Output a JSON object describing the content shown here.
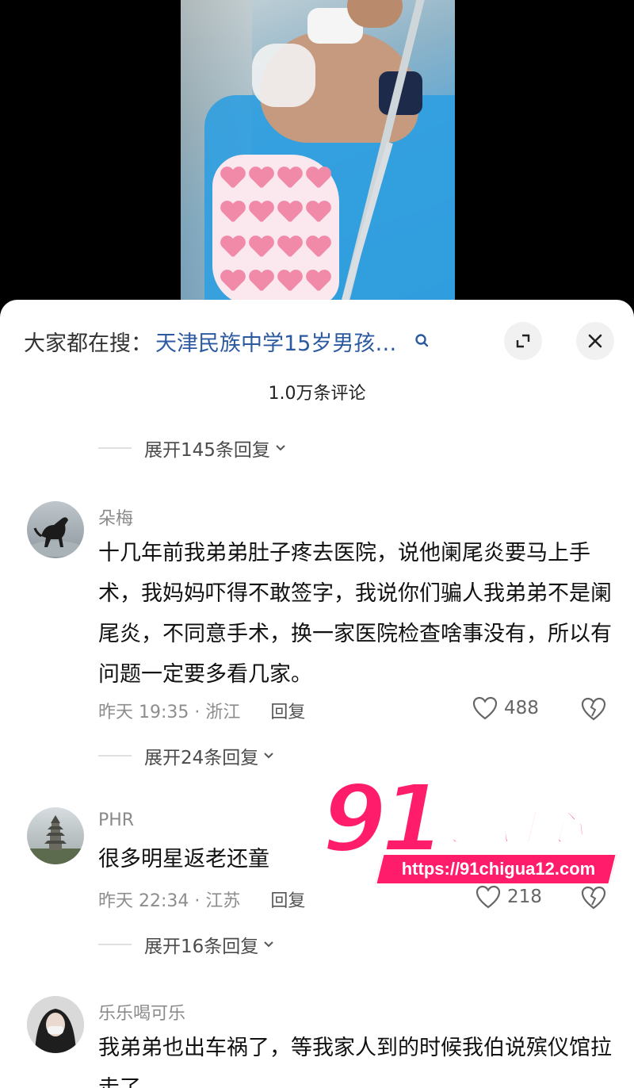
{
  "search": {
    "prefix": "大家都在搜：",
    "query": "天津民族中学15岁男孩…"
  },
  "header": {
    "comment_count": "1.0万条评论"
  },
  "top_reply_expand": "展开145条回复",
  "comments": [
    {
      "username": "朵梅",
      "text": "十几年前我弟弟肚子疼去医院，说他阑尾炎要马上手术，我妈妈吓得不敢签字，我说你们骗人我弟弟不是阑尾炎，不同意手术，换一家医院检查啥事没有，所以有问题一定要多看几家。",
      "meta": "昨天 19:35 · 浙江",
      "reply_label": "回复",
      "likes": "488",
      "expand_replies": "展开24条回复",
      "avatar_icon": "black-horse-avatar"
    },
    {
      "username": "PHR",
      "text": "很多明星返老还童",
      "meta": "昨天 22:34 · 江苏",
      "reply_label": "回复",
      "likes": "218",
      "expand_replies": "展开16条回复",
      "avatar_icon": "pagoda-avatar"
    },
    {
      "username": "乐乐喝可乐",
      "text": "我弟弟也出车祸了，等我家人到的时候我伯说殡仪馆拉走了",
      "avatar_icon": "masked-person-avatar"
    }
  ],
  "watermark": {
    "logo_number": "91",
    "brand": "吃瓜中心",
    "url": "https://91chigua12.com"
  },
  "colors": {
    "accent_link": "#2c5aa0",
    "watermark_pink": "#ff1d6b",
    "sheet_bg": "#ffffff",
    "video_bg": "#000000"
  }
}
